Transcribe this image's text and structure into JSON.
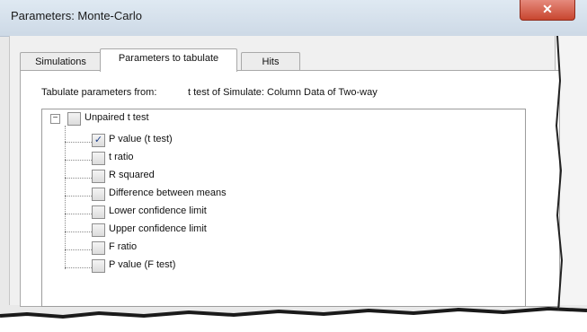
{
  "window": {
    "title": "Parameters: Monte-Carlo",
    "close_glyph": "✕"
  },
  "tabs": [
    {
      "label": "Simulations",
      "active": false
    },
    {
      "label": "Parameters to tabulate",
      "active": true
    },
    {
      "label": "Hits",
      "active": false
    }
  ],
  "tabulate": {
    "from_label": "Tabulate parameters from:",
    "from_value": "t test of Simulate: Column Data of Two-way"
  },
  "tree": {
    "root": {
      "label": "Unpaired t test",
      "expanded": true,
      "expander_glyph": "−",
      "checked": false
    },
    "items": [
      {
        "label": "P value (t test)",
        "checked": true
      },
      {
        "label": "t ratio",
        "checked": false
      },
      {
        "label": "R squared",
        "checked": false
      },
      {
        "label": "Difference between means",
        "checked": false
      },
      {
        "label": "Lower confidence limit",
        "checked": false
      },
      {
        "label": "Upper confidence limit",
        "checked": false
      },
      {
        "label": "F ratio",
        "checked": false
      },
      {
        "label": "P value (F test)",
        "checked": false
      }
    ],
    "check_glyph": "✓"
  },
  "colors": {
    "accent_check": "#1d3f8a",
    "close_button": "#c8462f"
  },
  "icons": {
    "close": "close-icon",
    "expander": "tree-collapse-icon",
    "checkbox": "checkbox-icon"
  }
}
